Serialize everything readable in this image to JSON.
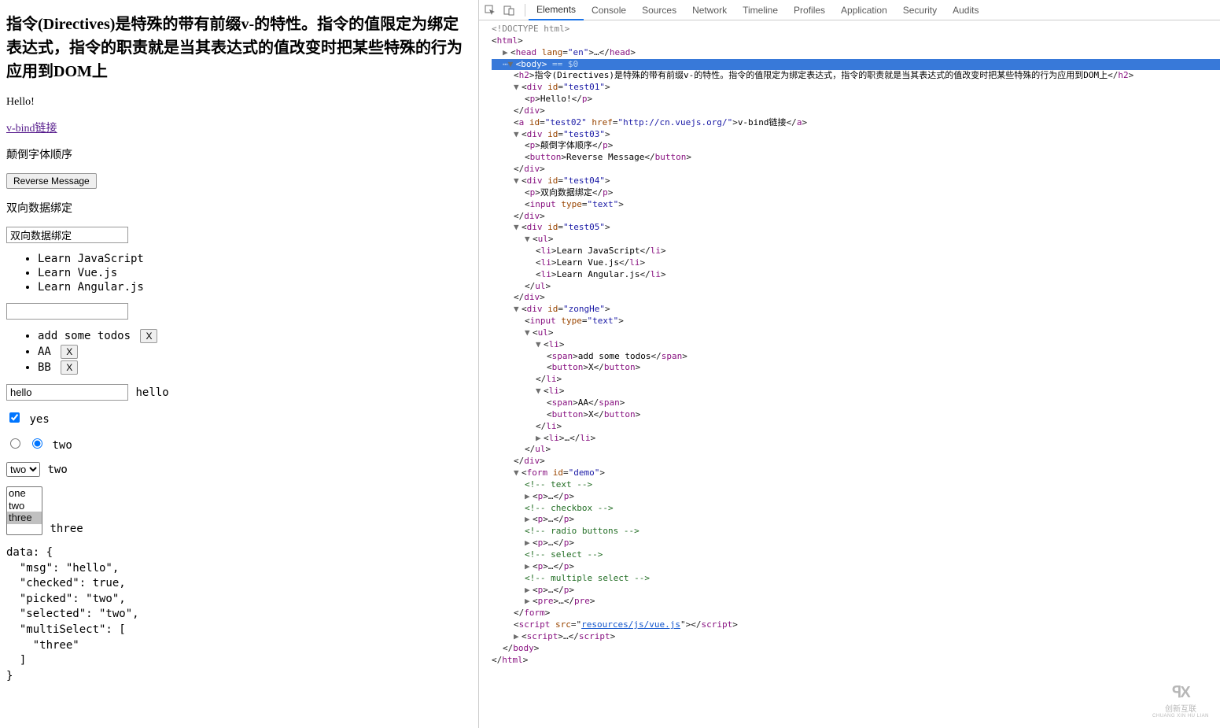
{
  "page": {
    "heading": "指令(Directives)是特殊的带有前缀v-的特性。指令的值限定为绑定表达式，指令的职责就是当其表达式的值改变时把某些特殊的行为应用到DOM上",
    "hello": "Hello!",
    "link_text": "v-bind链接",
    "link_href": "http://cn.vuejs.org/",
    "reverse_label": "颠倒字体顺序",
    "reverse_button": "Reverse Message",
    "twoway_label": "双向数据绑定",
    "twoway_value": "双向数据绑定",
    "list": [
      "Learn JavaScript",
      "Learn Vue.js",
      "Learn Angular.js"
    ],
    "todos": [
      {
        "text": "add some todos",
        "x": "X"
      },
      {
        "text": "AA",
        "x": "X"
      },
      {
        "text": "BB",
        "x": "X"
      }
    ],
    "form": {
      "text_value": "hello",
      "text_echo": "hello",
      "checkbox_label": "yes",
      "radio_label": "two",
      "select_options": [
        "one",
        "two",
        "three"
      ],
      "select_value": "two",
      "select_echo": "two",
      "multi_selected": "three",
      "multi_echo": "three",
      "pre": "data: {\n  \"msg\": \"hello\",\n  \"checked\": true,\n  \"picked\": \"two\",\n  \"selected\": \"two\",\n  \"multiSelect\": [\n    \"three\"\n  ]\n}"
    }
  },
  "devtools": {
    "tabs": [
      "Elements",
      "Console",
      "Sources",
      "Network",
      "Timeline",
      "Profiles",
      "Application",
      "Security",
      "Audits"
    ],
    "active_tab": "Elements",
    "dom": {
      "doctype": "<!DOCTYPE html>",
      "html_open": "html",
      "head": {
        "tag": "head",
        "attr": "lang=\"en\"",
        "ellipsis": "…"
      },
      "body_selected": "<body> == $0",
      "h2_text": "指令(Directives)是特殊的带有前缀v-的特性。指令的值限定为绑定表达式，指令的职责就是当其表达式的值改变时把某些特殊的行为应用到DOM上",
      "test01_p": "Hello!",
      "a_id": "test02",
      "a_href": "http://cn.vuejs.org/",
      "a_text": "v-bind链接",
      "test03_p": "颠倒字体顺序",
      "test03_btn": "Reverse Message",
      "test04_p": "双向数据绑定",
      "input_type": "text",
      "test05_li": [
        "Learn JavaScript",
        "Learn Vue.js",
        "Learn Angular.js"
      ],
      "zonghe_span1": "add some todos",
      "zonghe_btn": "X",
      "zonghe_span2": "AA",
      "form_id": "demo",
      "comments": [
        "<!-- text -->",
        "<!-- checkbox -->",
        "<!-- radio buttons -->",
        "<!-- select -->",
        "<!-- multiple select -->"
      ],
      "script_src": "resources/js/vue.js"
    }
  },
  "watermark": {
    "brand": "创新互联",
    "sub": "CHUANG XIN HU LIAN"
  }
}
